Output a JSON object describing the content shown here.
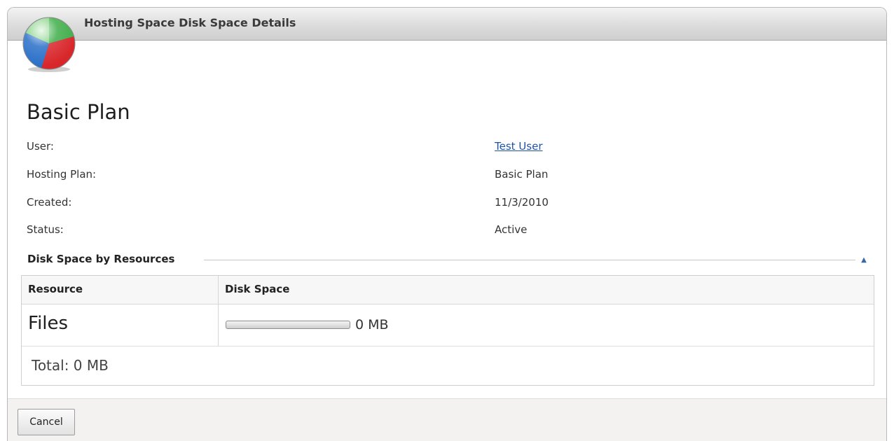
{
  "window": {
    "title": "Hosting Space Disk Space Details",
    "logo_icon": "pie-chart-globe-icon"
  },
  "plan": {
    "name": "Basic Plan"
  },
  "info": {
    "user_label": "User:",
    "user_value": "Test User",
    "hosting_plan_label": "Hosting Plan:",
    "hosting_plan_value": "Basic Plan",
    "created_label": "Created:",
    "created_value": "11/3/2010",
    "status_label": "Status:",
    "status_value": "Active"
  },
  "section": {
    "title": "Disk Space by Resources",
    "collapse_icon": "chevron-up-icon"
  },
  "table": {
    "columns": [
      "Resource",
      "Disk Space"
    ],
    "rows": [
      {
        "resource": "Files",
        "disk_space": "0 MB",
        "usage_fraction": 0
      }
    ],
    "total": "Total: 0 MB"
  },
  "footer": {
    "cancel_label": "Cancel"
  },
  "colors": {
    "link": "#1f53a8",
    "titlebar": "#dcdcdc",
    "footer": "#f4f1f1"
  }
}
